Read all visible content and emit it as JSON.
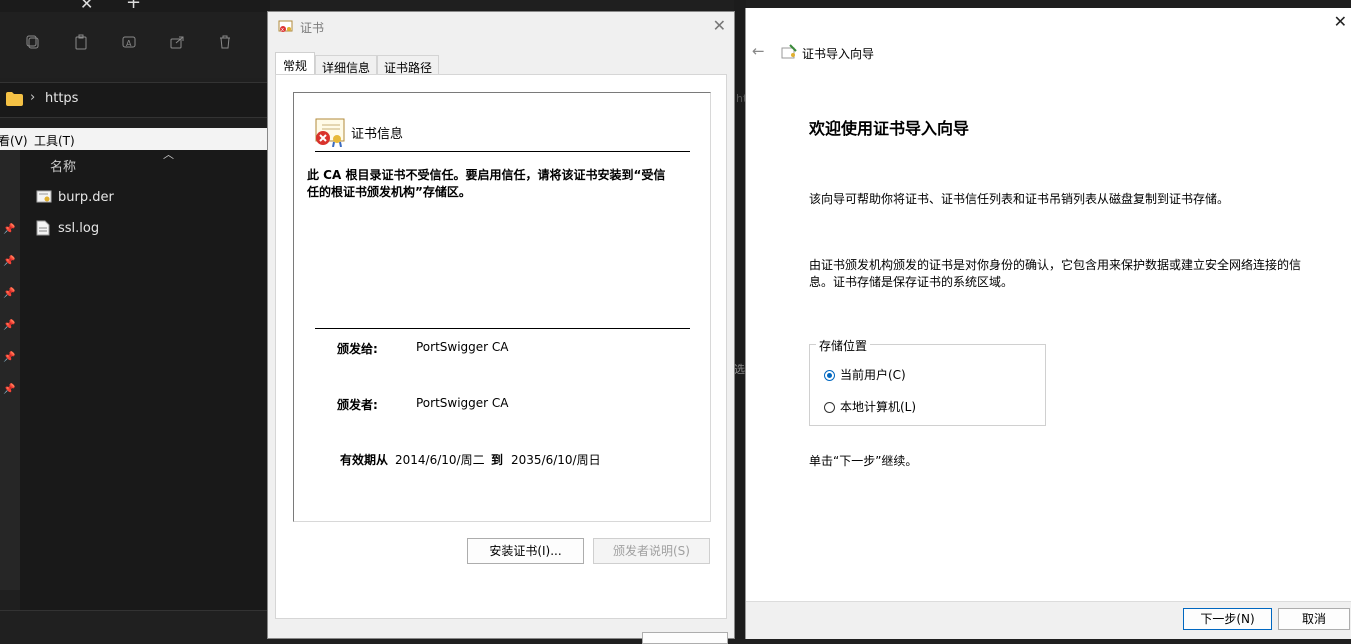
{
  "explorer": {
    "tab_close": "✕",
    "tab_add": "+",
    "address": "https",
    "menu_left": "看(V)",
    "menu_tools": "工具(T)",
    "column_name": "名称",
    "files": [
      {
        "name": "burp.der",
        "icon": "certificate-file-icon"
      },
      {
        "name": "ssl.log",
        "icon": "text-file-icon"
      }
    ],
    "peek_right_1": "ht",
    "peek_right_2": "选"
  },
  "cert_dialog": {
    "title": "证书",
    "tabs": [
      "常规",
      "详细信息",
      "证书路径"
    ],
    "section_title": "证书信息",
    "warning": "此 CA 根目录证书不受信任。要启用信任，请将该证书安装到“受信任的根证书颁发机构”存储区。",
    "issued_to_label": "颁发给:",
    "issued_to": "PortSwigger CA",
    "issued_by_label": "颁发者:",
    "issued_by": "PortSwigger CA",
    "valid_from_label": "有效期从",
    "valid_from": "2014/6/10/周二",
    "to_label": "到",
    "valid_to": "2035/6/10/周日",
    "install_button": "安装证书(I)...",
    "issuer_statement_button": "颁发者说明(S)"
  },
  "wizard": {
    "title": "证书导入向导",
    "heading": "欢迎使用证书导入向导",
    "para1": "该向导可帮助你将证书、证书信任列表和证书吊销列表从磁盘复制到证书存储。",
    "para2": "由证书颁发机构颁发的证书是对你身份的确认，它包含用来保护数据或建立安全网络连接的信息。证书存储是保存证书的系统区域。",
    "store_group_label": "存储位置",
    "option_current_user": "当前用户(C)",
    "option_local_machine": "本地计算机(L)",
    "selected_option": "current_user",
    "continue_hint": "单击“下一步”继续。",
    "next_button": "下一步(N)",
    "cancel_button": "取消",
    "accent_color": "#0067c0"
  }
}
